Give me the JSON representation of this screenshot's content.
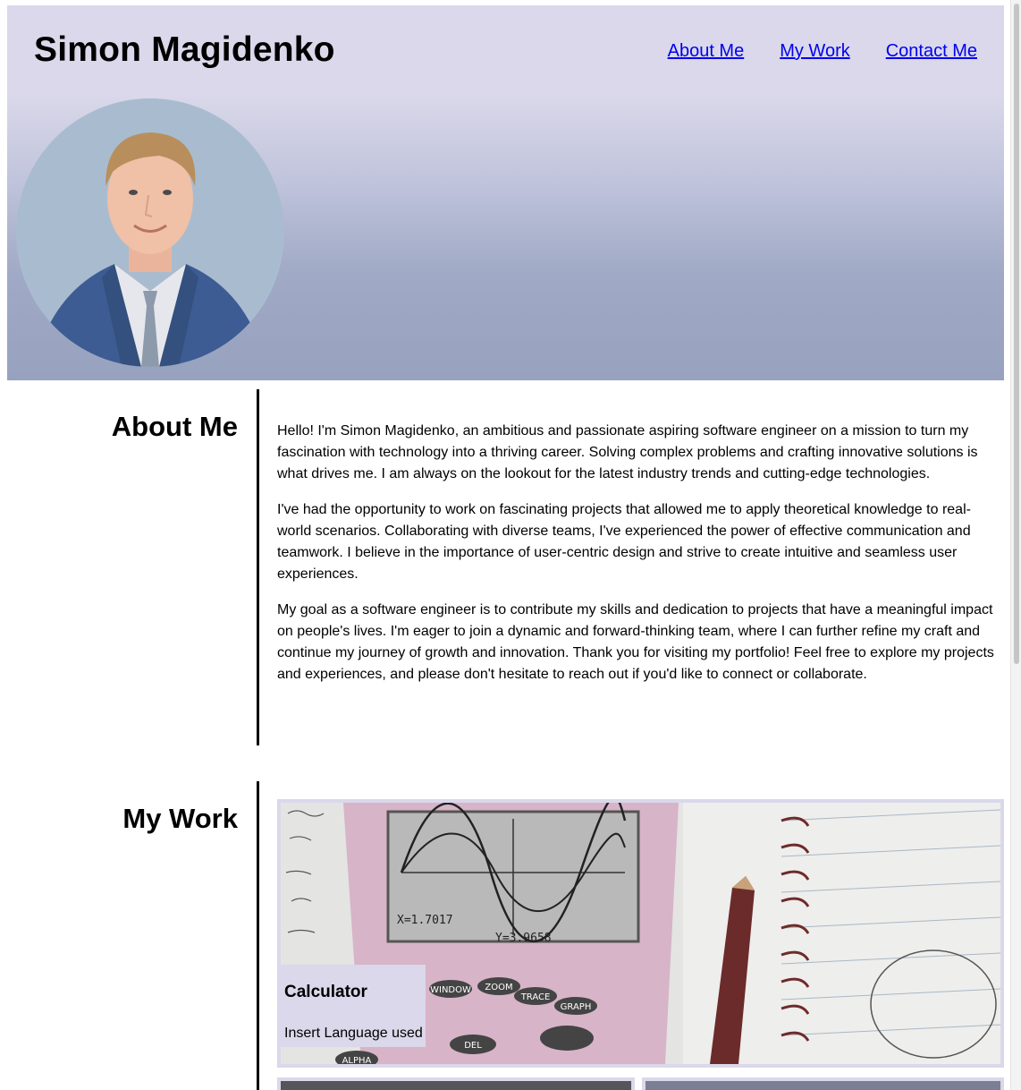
{
  "header": {
    "title": "Simon Magidenko",
    "nav": [
      {
        "label": "About Me"
      },
      {
        "label": "My Work"
      },
      {
        "label": "Contact Me"
      }
    ]
  },
  "about": {
    "heading": "About Me",
    "paragraphs": [
      "Hello! I'm Simon Magidenko, an ambitious and passionate aspiring software engineer on a mission to turn my fascination with technology into a thriving career. Solving complex problems and crafting innovative solutions is what drives me. I am always on the lookout for the latest industry trends and cutting-edge technologies.",
      "I've had the opportunity to work on fascinating projects that allowed me to apply theoretical knowledge to real-world scenarios. Collaborating with diverse teams, I've experienced the power of effective communication and teamwork. I believe in the importance of user-centric design and strive to create intuitive and seamless user experiences.",
      "My goal as a software engineer is to contribute my skills and dedication to projects that have a meaningful impact on people's lives. I'm eager to join a dynamic and forward-thinking team, where I can further refine my craft and continue my journey of growth and innovation. Thank you for visiting my portfolio! Feel free to explore my projects and experiences, and please don't hesitate to reach out if you'd like to connect or collaborate."
    ]
  },
  "work": {
    "heading": "My Work",
    "projects": [
      {
        "title": "Calculator",
        "language": "Insert Language used"
      }
    ]
  },
  "calculator_image_text": {
    "readout_x": "X=1.7017",
    "readout_y": "Y=3.9658",
    "keys": [
      "WINDOW",
      "ZOOM",
      "TRACE",
      "GRAPH",
      "DEL",
      "ALPHA"
    ]
  },
  "colors": {
    "header_top": "#dad8ea",
    "header_bottom": "#97a2bf",
    "link": "#0000ee",
    "card_bg": "#dad8ea"
  }
}
